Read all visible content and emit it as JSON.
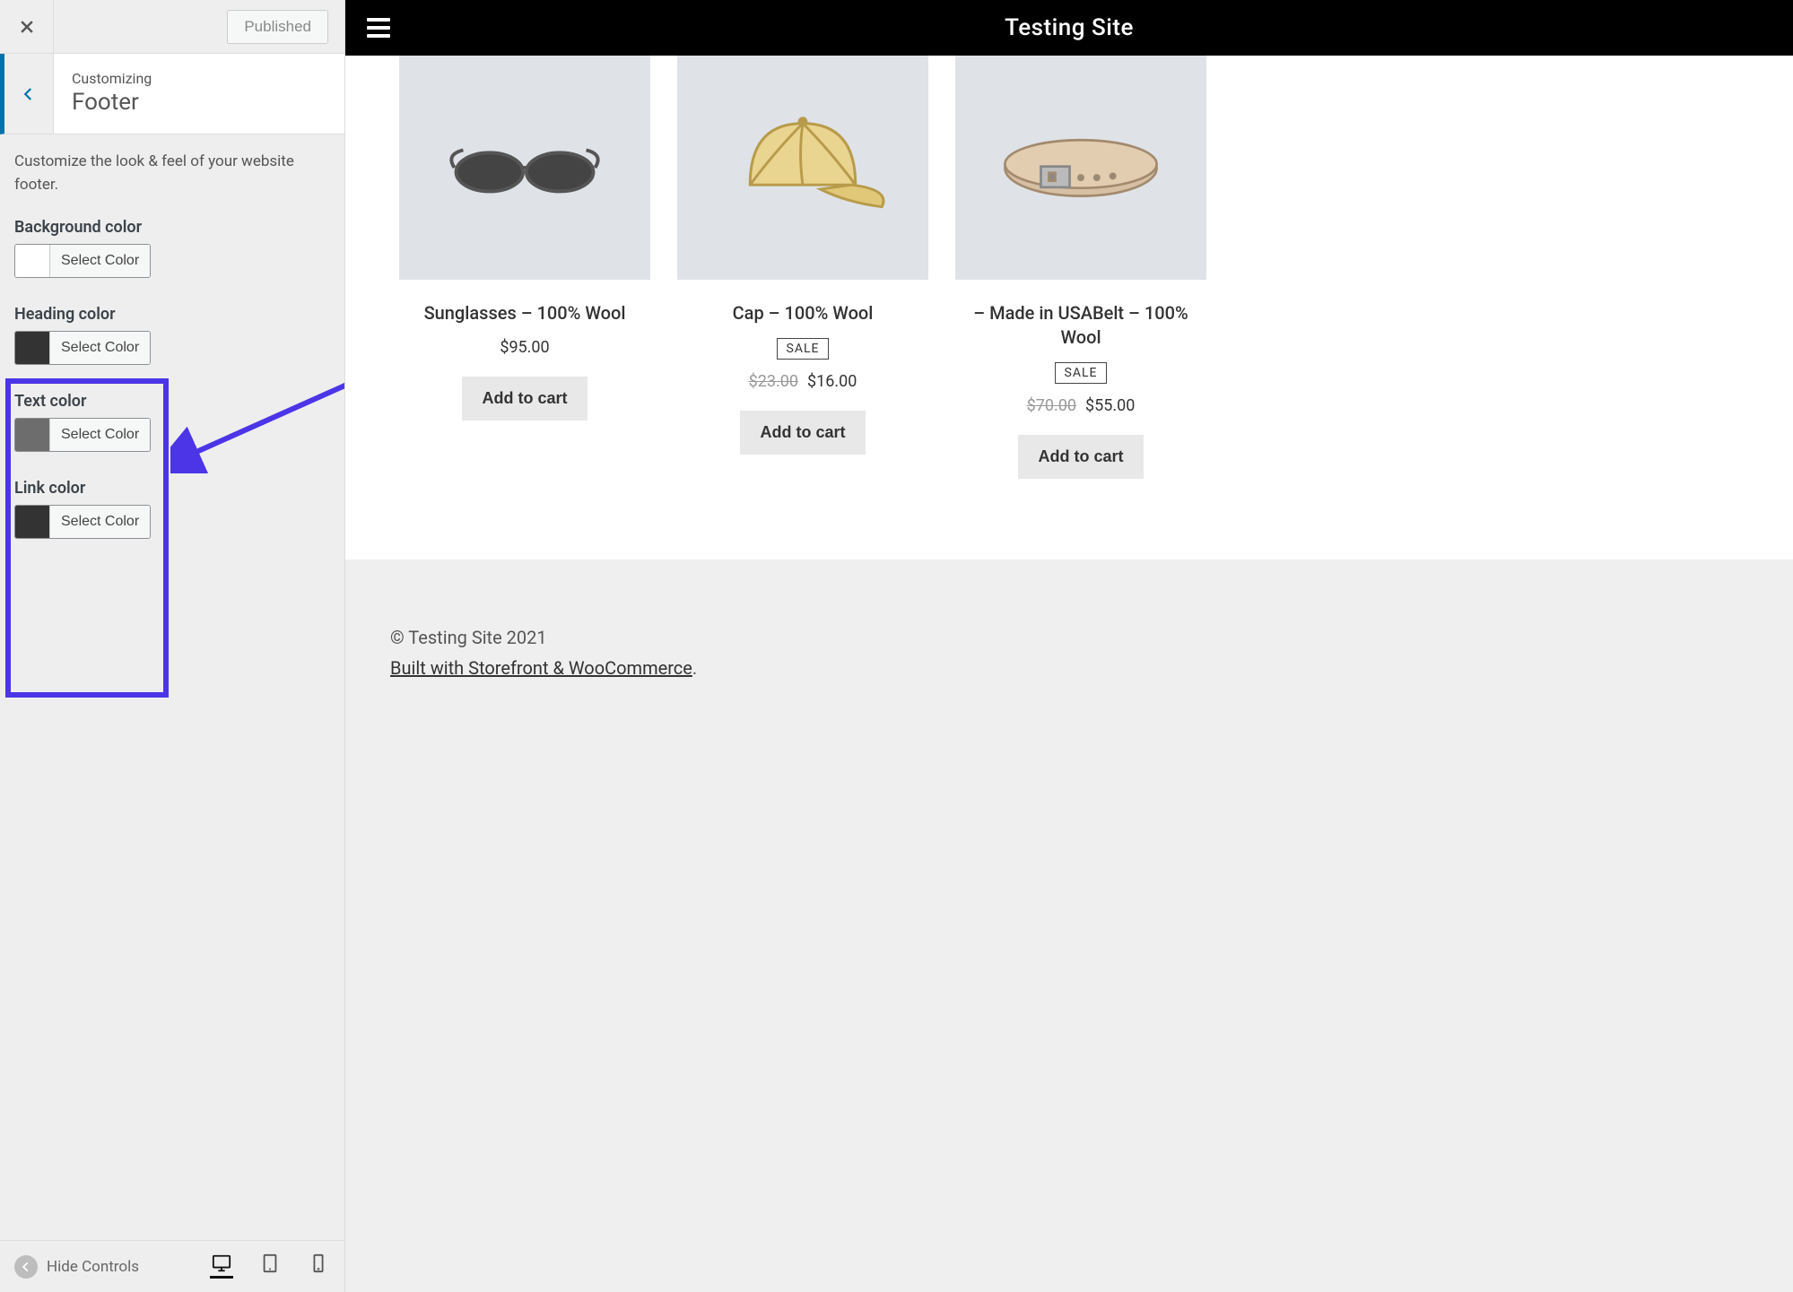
{
  "sidebar": {
    "publish_label": "Published",
    "breadcrumb_label": "Customizing",
    "breadcrumb_title": "Footer",
    "description": "Customize the look & feel of your website footer.",
    "hide_controls_label": "Hide Controls",
    "color_controls": [
      {
        "label": "Background color",
        "swatch": "#ffffff",
        "button": "Select Color"
      },
      {
        "label": "Heading color",
        "swatch": "#333333",
        "button": "Select Color"
      },
      {
        "label": "Text color",
        "swatch": "#6d6d6d",
        "button": "Select Color"
      },
      {
        "label": "Link color",
        "swatch": "#333333",
        "button": "Select Color"
      }
    ]
  },
  "annotation": {
    "highlight_color": "#4b35e7"
  },
  "preview": {
    "site_title": "Testing Site",
    "sale_label": "SALE",
    "add_to_cart_label": "Add to cart",
    "products": [
      {
        "title": "Sunglasses – 100% Wool",
        "old_price": "",
        "price": "$95.00",
        "sale": false,
        "icon": "sunglasses"
      },
      {
        "title": "Cap – 100% Wool",
        "old_price": "$23.00",
        "price": "$16.00",
        "sale": true,
        "icon": "cap"
      },
      {
        "title": "– Made in USABelt – 100% Wool",
        "old_price": "$70.00",
        "price": "$55.00",
        "sale": true,
        "icon": "belt"
      }
    ],
    "footer_copyright": "© Testing Site 2021",
    "footer_credit": "Built with Storefront & WooCommerce",
    "footer_credit_suffix": "."
  }
}
